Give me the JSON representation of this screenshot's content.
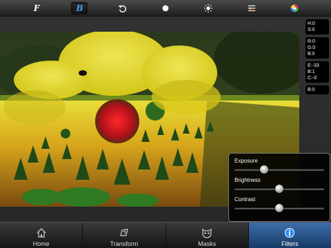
{
  "toolbar": {
    "buttons": [
      {
        "name": "font-italic",
        "label": "F"
      },
      {
        "name": "bold",
        "label": "B"
      },
      {
        "name": "undo-icon"
      },
      {
        "name": "circle-icon"
      },
      {
        "name": "brightness-icon"
      },
      {
        "name": "sliders-icon"
      },
      {
        "name": "color-wheel-icon"
      }
    ]
  },
  "info": {
    "hs": [
      {
        "k": "H:",
        "v": "0"
      },
      {
        "k": "S:",
        "v": "0"
      }
    ],
    "rgb": [
      {
        "k": "R:",
        "v": "0"
      },
      {
        "k": "G:",
        "v": "0"
      },
      {
        "k": "B:",
        "v": "0"
      }
    ],
    "ebc": [
      {
        "k": "E:",
        "v": "-33"
      },
      {
        "k": "B:",
        "v": "1"
      },
      {
        "k": "C:",
        "v": "-0"
      }
    ],
    "blur": [
      {
        "k": "B:",
        "v": "0"
      }
    ]
  },
  "adjust": {
    "exposure": {
      "label": "Exposure",
      "value": 0.33
    },
    "brightness": {
      "label": "Brightness",
      "value": 0.5
    },
    "contrast": {
      "label": "Contrast",
      "value": 0.5
    }
  },
  "tabs": [
    {
      "label": "Home",
      "icon": "home-icon",
      "active": false
    },
    {
      "label": "Transform",
      "icon": "transform-icon",
      "active": false
    },
    {
      "label": "Masks",
      "icon": "mask-icon",
      "active": false
    },
    {
      "label": "Filters",
      "icon": "info-icon",
      "active": true
    }
  ],
  "colors": {
    "accent": "#3aa0ff",
    "active_tab": "#2f5d95"
  }
}
